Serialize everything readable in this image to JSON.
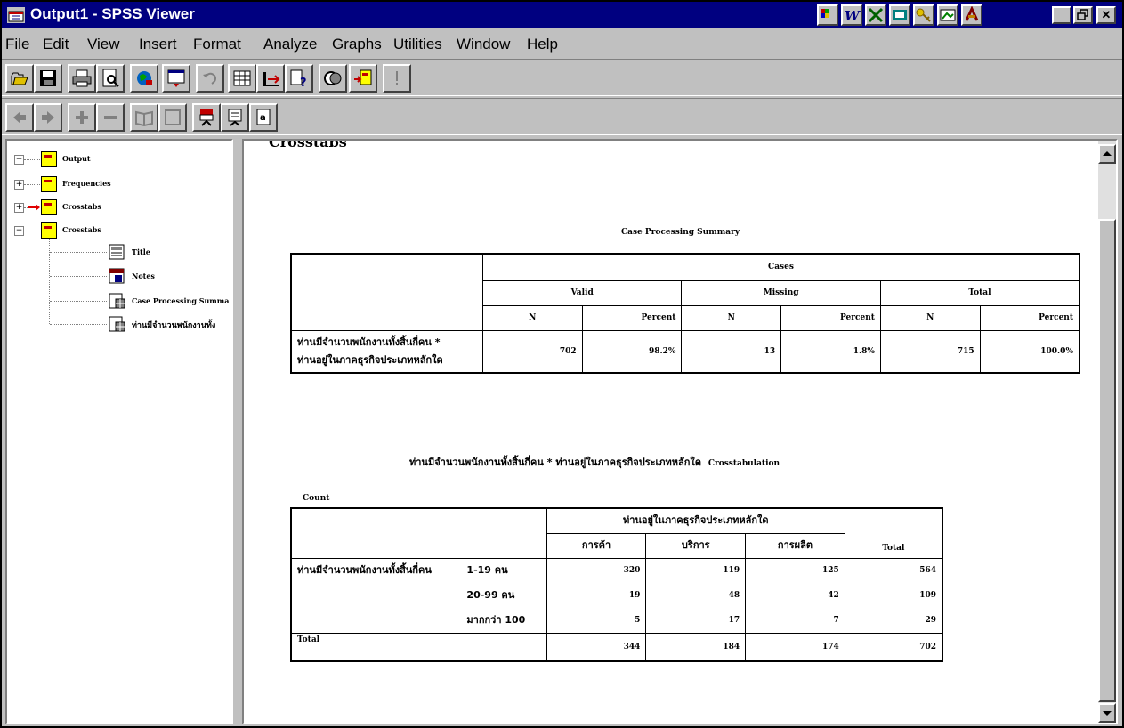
{
  "window": {
    "title": "Output1 - SPSS Viewer",
    "title_color": "#000080",
    "tray_icons": [
      "sigma-icon",
      "word-icon",
      "excel-icon",
      "outlook-icon",
      "key-icon",
      "image-icon",
      "access-icon"
    ],
    "controls": [
      "minimize-icon",
      "restore-icon",
      "close-icon"
    ]
  },
  "menu": {
    "items": [
      "File",
      "Edit",
      "View",
      "Insert",
      "Format",
      "Analyze",
      "Graphs",
      "Utilities",
      "Window",
      "Help"
    ]
  },
  "toolbar1": {
    "buttons": [
      "open-icon",
      "save-icon",
      "print-icon",
      "print-preview-icon",
      "export-icon",
      "recall-dialog-icon",
      "undo-icon",
      "goto-data-icon",
      "goto-case-icon",
      "variables-icon",
      "use-sets-icon",
      "select-last-output-icon",
      "designate-window-icon"
    ]
  },
  "toolbar2": {
    "buttons": [
      "promote-icon",
      "demote-icon",
      "expand-icon",
      "collapse-icon",
      "show-icon",
      "hide-icon",
      "insert-heading-icon",
      "insert-title-icon",
      "insert-text-icon"
    ]
  },
  "outline": {
    "items": [
      {
        "label": "Output",
        "level": 0
      },
      {
        "label": "Frequencies",
        "level": 1
      },
      {
        "label": "Crosstabs",
        "level": 1
      },
      {
        "label": "Crosstabs",
        "level": 1
      },
      {
        "label": "Title",
        "level": 2
      },
      {
        "label": "Notes",
        "level": 2
      },
      {
        "label": "Case Processing Summa",
        "level": 2
      },
      {
        "label": "ท่านมีจำนวนพนักงานทั้ง",
        "level": 2
      }
    ]
  },
  "content": {
    "heading": "Crosstabs",
    "case_summary": {
      "title": "Case Processing Summary",
      "cases_label": "Cases",
      "groups": [
        "Valid",
        "Missing",
        "Total"
      ],
      "subheaders": [
        "N",
        "Percent",
        "N",
        "Percent",
        "N",
        "Percent"
      ],
      "row_label_line1": "ท่านมีจำนวนพนักงานทั้งสิ้นกี่คน *",
      "row_label_line2": "ท่านอยู่ในภาคธุรกิจประเภทหลักใด",
      "values": [
        "702",
        "98.2%",
        "13",
        "1.8%",
        "715",
        "100.0%"
      ]
    },
    "crosstab": {
      "title_thai": "ท่านมีจำนวนพนักงานทั้งสิ้นกี่คน * ท่านอยู่ในภาคธุรกิจประเภทหลักใด",
      "title_suffix": "Crosstabulation",
      "count_label": "Count",
      "col_var": "ท่านอยู่ในภาคธุรกิจประเภทหลักใด",
      "col_categories": [
        "การค้า",
        "บริการ",
        "การผลิต"
      ],
      "total_label": "Total",
      "row_var": "ท่านมีจำนวนพนักงานทั้งสิ้นกี่คน",
      "rows": [
        {
          "label": "1-19 คน",
          "values": [
            "320",
            "119",
            "125",
            "564"
          ]
        },
        {
          "label": "20-99 คน",
          "values": [
            "19",
            "48",
            "42",
            "109"
          ]
        },
        {
          "label": "มากกว่า 100",
          "values": [
            "5",
            "17",
            "7",
            "29"
          ]
        }
      ],
      "total_row": {
        "label": "Total",
        "values": [
          "344",
          "184",
          "174",
          "702"
        ]
      }
    }
  }
}
